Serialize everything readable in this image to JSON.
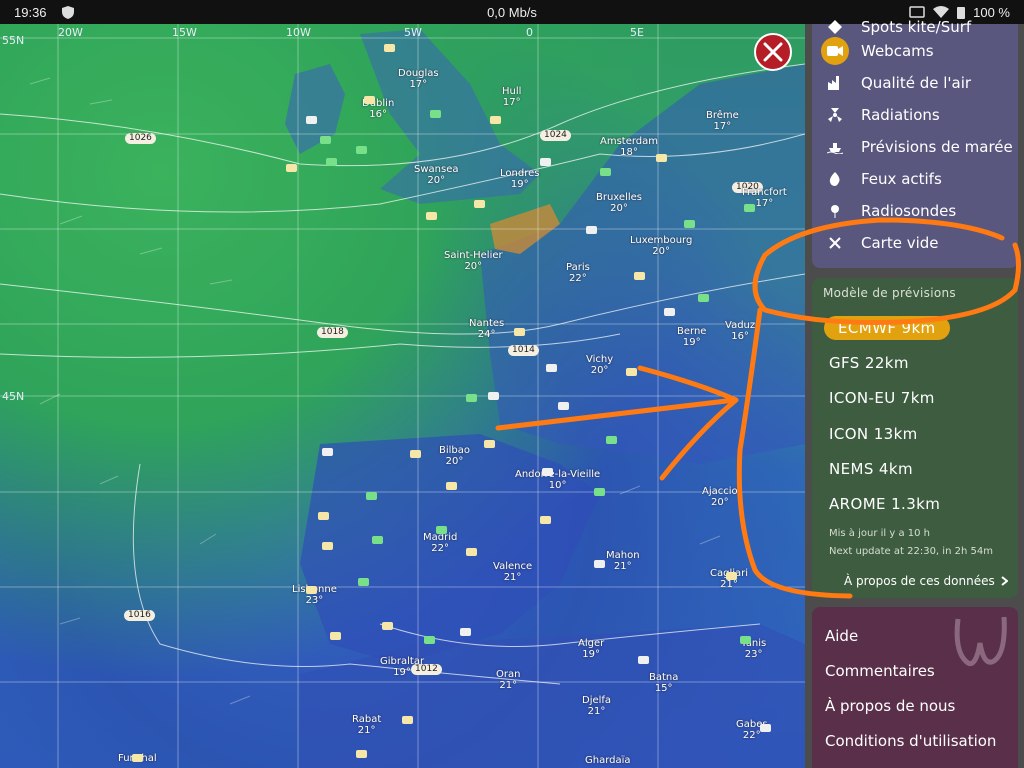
{
  "status": {
    "time": "19:36",
    "speed": "0,0 Mb/s",
    "battery": "100 %"
  },
  "map": {
    "coords": [
      "20W",
      "15W",
      "10W",
      "5W",
      "0",
      "5E",
      "45N",
      "55N"
    ],
    "pressures": [
      "1026",
      "1024",
      "1020",
      "1018",
      "1014",
      "1016",
      "1012"
    ],
    "cities": [
      {
        "name": "Douglas",
        "temp": "17°"
      },
      {
        "name": "Hull",
        "temp": "17°"
      },
      {
        "name": "Dublin",
        "temp": "16°"
      },
      {
        "name": "Brême",
        "temp": "17°"
      },
      {
        "name": "Amsterdam",
        "temp": "18°"
      },
      {
        "name": "Swansea",
        "temp": "20°"
      },
      {
        "name": "Londres",
        "temp": "19°"
      },
      {
        "name": "Francfort",
        "temp": "17°"
      },
      {
        "name": "Bruxelles",
        "temp": "20°"
      },
      {
        "name": "Luxembourg",
        "temp": "20°"
      },
      {
        "name": "Saint-Helier",
        "temp": "20°"
      },
      {
        "name": "Paris",
        "temp": "22°"
      },
      {
        "name": "Nantes",
        "temp": "24°"
      },
      {
        "name": "Berne",
        "temp": "19°"
      },
      {
        "name": "Vaduz",
        "temp": "16°"
      },
      {
        "name": "Vichy",
        "temp": "20°"
      },
      {
        "name": "Bilbao",
        "temp": "20°"
      },
      {
        "name": "Andorre-la-Vieille",
        "temp": "10°"
      },
      {
        "name": "Madrid",
        "temp": "22°"
      },
      {
        "name": "Valence",
        "temp": "21°"
      },
      {
        "name": "Mahon",
        "temp": "21°"
      },
      {
        "name": "Lisbonne",
        "temp": "23°"
      },
      {
        "name": "Alger",
        "temp": "19°"
      },
      {
        "name": "Gibraltar",
        "temp": "19°"
      },
      {
        "name": "Oran",
        "temp": "21°"
      },
      {
        "name": "Tunis",
        "temp": "23°"
      },
      {
        "name": "Batna",
        "temp": "15°"
      },
      {
        "name": "Djelfa",
        "temp": "21°"
      },
      {
        "name": "Rabat",
        "temp": "21°"
      },
      {
        "name": "Gabes",
        "temp": "22°"
      },
      {
        "name": "Ajaccio",
        "temp": "20°"
      },
      {
        "name": "Cagliari",
        "temp": "21°"
      },
      {
        "name": "Ghardaïa",
        "temp": ""
      },
      {
        "name": "Funchal",
        "temp": ""
      }
    ]
  },
  "layers": {
    "items": [
      {
        "label": "Spots kite/Surf",
        "icon": "kite-icon"
      },
      {
        "label": "Webcams",
        "icon": "webcam-icon",
        "active": true
      },
      {
        "label": "Qualité de l'air",
        "icon": "factory-icon"
      },
      {
        "label": "Radiations",
        "icon": "radiation-icon"
      },
      {
        "label": "Prévisions de marée",
        "icon": "ship-icon"
      },
      {
        "label": "Feux actifs",
        "icon": "fire-icon"
      },
      {
        "label": "Radiosondes",
        "icon": "balloon-icon"
      },
      {
        "label": "Carte vide",
        "icon": "close-icon"
      }
    ]
  },
  "forecast": {
    "title": "Modèle de prévisions",
    "selected": "ECMWF 9km",
    "models": [
      "GFS 22km",
      "ICON-EU 7km",
      "ICON 13km",
      "NEMS 4km",
      "AROME 1.3km"
    ],
    "updated": "Mis à jour il y a 10 h",
    "next_update": "Next update at 22:30, in 2h 54m",
    "about_link": "À propos de ces données"
  },
  "menu": {
    "items": [
      "Aide",
      "Commentaires",
      "À propos de nous",
      "Conditions d'utilisation"
    ]
  },
  "colors": {
    "accent": "#e2a20f",
    "annotation": "#ff7a12",
    "close": "#b51d27"
  }
}
